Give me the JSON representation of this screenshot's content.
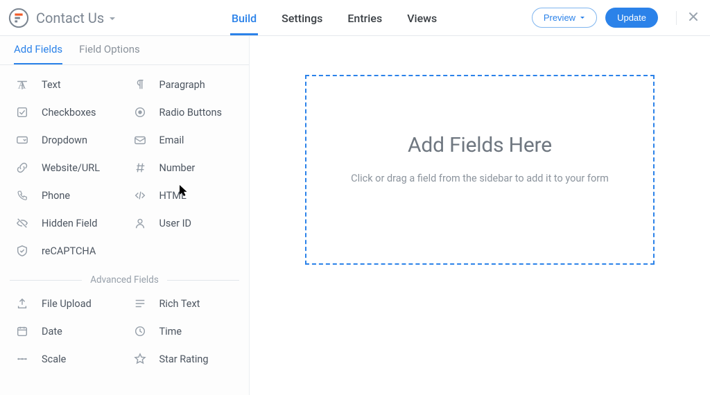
{
  "header": {
    "form_name": "Contact Us",
    "tabs": {
      "build": "Build",
      "settings": "Settings",
      "entries": "Entries",
      "views": "Views"
    },
    "preview_label": "Preview",
    "update_label": "Update"
  },
  "sidebar": {
    "tabs": {
      "add_fields": "Add Fields",
      "field_options": "Field Options"
    },
    "basic_fields": [
      {
        "label": "Text",
        "icon": "text"
      },
      {
        "label": "Paragraph",
        "icon": "paragraph"
      },
      {
        "label": "Checkboxes",
        "icon": "checkbox"
      },
      {
        "label": "Radio Buttons",
        "icon": "radio"
      },
      {
        "label": "Dropdown",
        "icon": "dropdown"
      },
      {
        "label": "Email",
        "icon": "email"
      },
      {
        "label": "Website/URL",
        "icon": "link"
      },
      {
        "label": "Number",
        "icon": "hash"
      },
      {
        "label": "Phone",
        "icon": "phone"
      },
      {
        "label": "HTML",
        "icon": "code"
      },
      {
        "label": "Hidden Field",
        "icon": "hidden"
      },
      {
        "label": "User ID",
        "icon": "user"
      },
      {
        "label": "reCAPTCHA",
        "icon": "shield"
      }
    ],
    "advanced_label": "Advanced Fields",
    "advanced_fields": [
      {
        "label": "File Upload",
        "icon": "upload"
      },
      {
        "label": "Rich Text",
        "icon": "richtext"
      },
      {
        "label": "Date",
        "icon": "calendar"
      },
      {
        "label": "Time",
        "icon": "clock"
      },
      {
        "label": "Scale",
        "icon": "scale"
      },
      {
        "label": "Star Rating",
        "icon": "star"
      }
    ]
  },
  "canvas": {
    "heading": "Add Fields Here",
    "hint": "Click or drag a field from the sidebar to add it to your form"
  },
  "colors": {
    "accent": "#2b82e9"
  }
}
